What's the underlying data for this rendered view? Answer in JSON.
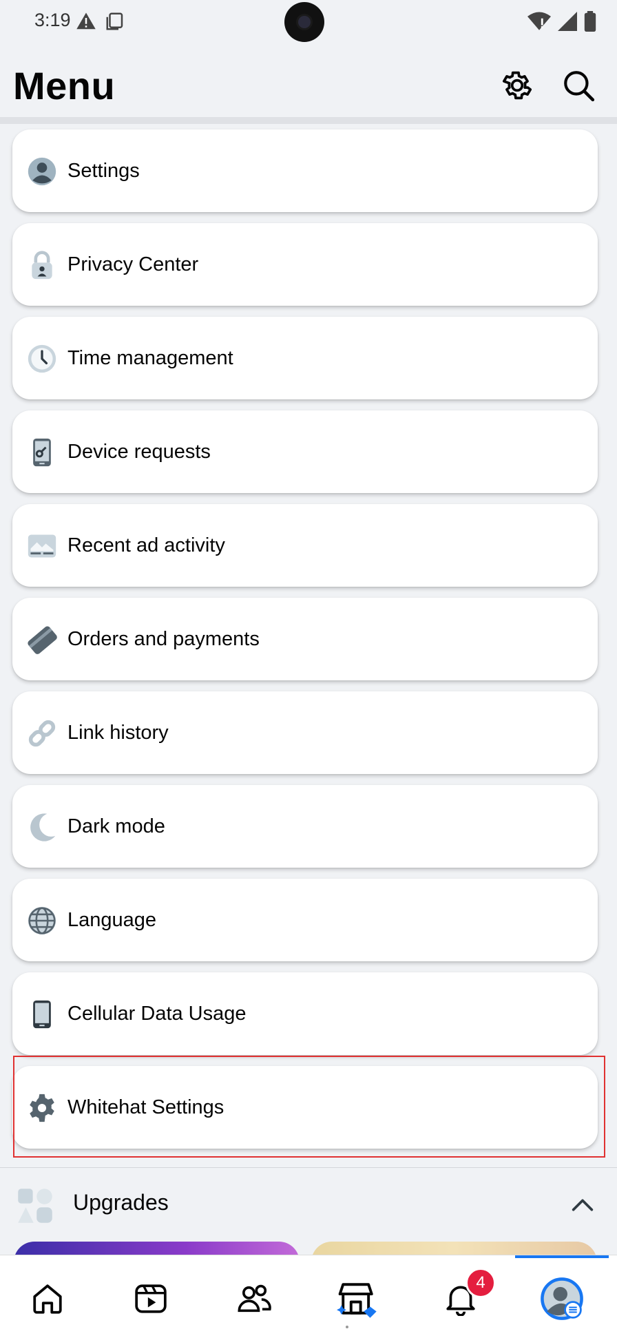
{
  "status_bar": {
    "time": "3:19"
  },
  "header": {
    "title": "Menu"
  },
  "menu_items": [
    {
      "label": "Settings",
      "icon": "account-circle-icon"
    },
    {
      "label": "Privacy Center",
      "icon": "lock-icon"
    },
    {
      "label": "Time management",
      "icon": "clock-icon"
    },
    {
      "label": "Device requests",
      "icon": "phone-key-icon"
    },
    {
      "label": "Recent ad activity",
      "icon": "ad-image-icon"
    },
    {
      "label": "Orders and payments",
      "icon": "card-icon"
    },
    {
      "label": "Link history",
      "icon": "link-icon"
    },
    {
      "label": "Dark mode",
      "icon": "moon-icon"
    },
    {
      "label": "Language",
      "icon": "globe-icon"
    },
    {
      "label": "Cellular Data Usage",
      "icon": "phone-icon"
    },
    {
      "label": "Whitehat Settings",
      "icon": "gear-icon"
    }
  ],
  "upgrades": {
    "title": "Upgrades"
  },
  "bottom_nav": {
    "items": [
      "home",
      "video",
      "friends",
      "marketplace",
      "notifications",
      "profile-menu"
    ],
    "notification_count": "4",
    "active": "profile-menu"
  },
  "colors": {
    "accent": "#1877f2",
    "badge": "#e41e3f",
    "highlight": "#e03131",
    "background": "#f0f2f5"
  }
}
